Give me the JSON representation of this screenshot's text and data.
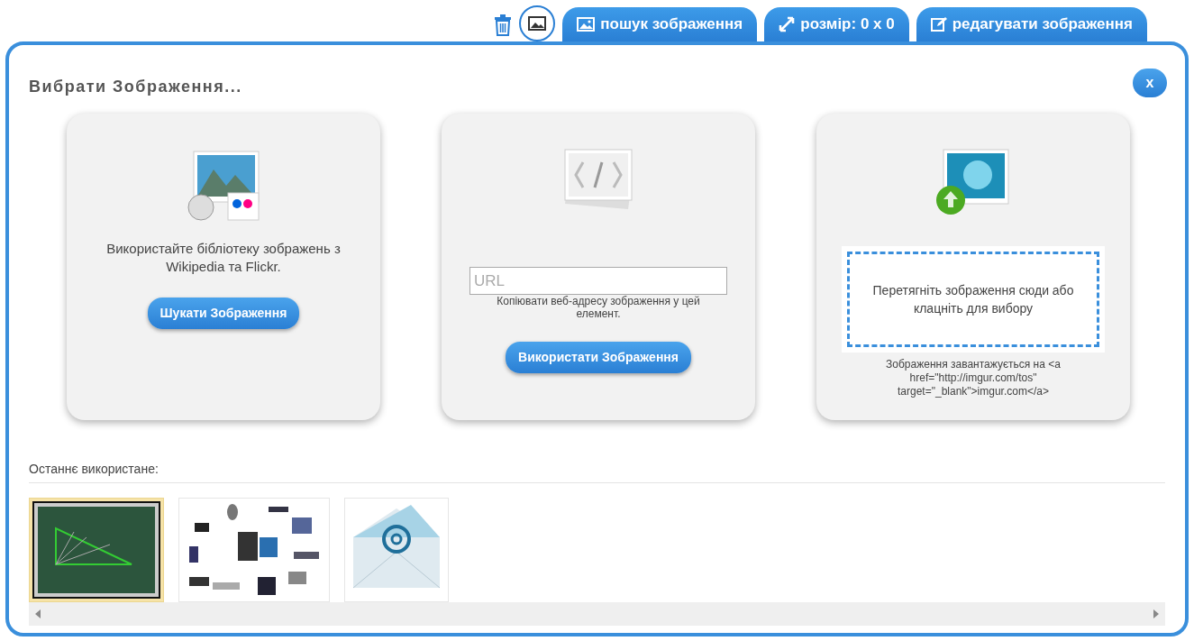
{
  "toolbar": {
    "buttons": [
      {
        "kind": "delete"
      },
      {
        "kind": "image"
      },
      {
        "kind": "search",
        "label": "пошук зображення"
      },
      {
        "kind": "resize",
        "label": "розмір: 0 x 0"
      },
      {
        "kind": "edit",
        "label": "редагувати зображення"
      }
    ]
  },
  "dialog": {
    "title": "Вибрати Зображення...",
    "close": "x",
    "options": [
      {
        "kind": "library",
        "text": "Використайте бібліотеку зображень з Wikipedia та Flickr.",
        "button": "Шукати Зображення"
      },
      {
        "kind": "url",
        "placeholder": "URL",
        "hint": "Копіювати веб-адресу зображення у цей елемент.",
        "button": "Використати Зображення"
      },
      {
        "kind": "upload",
        "drop_text": "Перетягніть зображення сюди або клацніть для вибору",
        "note": "Зображення завантажується на <a href=\"http://imgur.com/tos\" target=\"_blank\">imgur.com</a>"
      }
    ],
    "recent": {
      "label": "Останнє використане:",
      "items": [
        {
          "kind": "chalkboard",
          "selected": true
        },
        {
          "kind": "devices",
          "selected": false
        },
        {
          "kind": "email",
          "selected": false
        }
      ]
    }
  }
}
